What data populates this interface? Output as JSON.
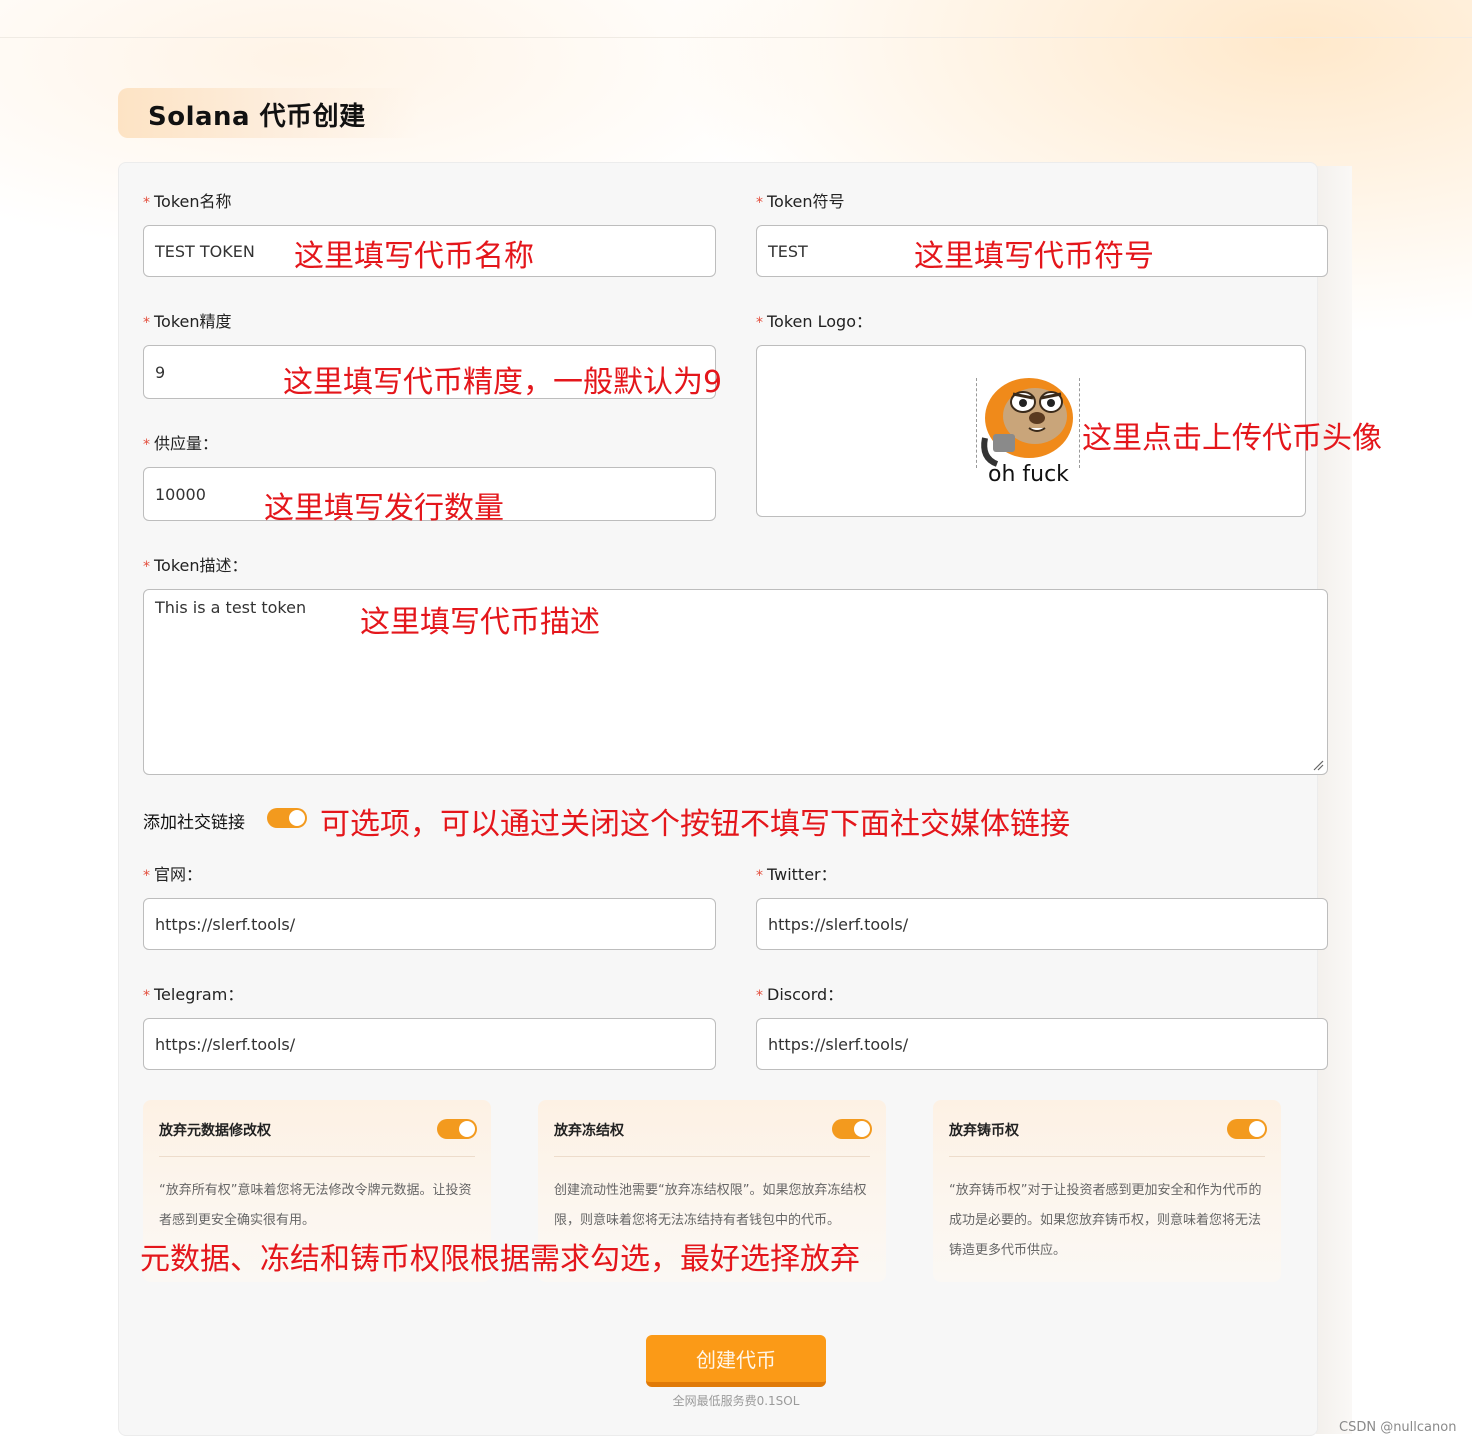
{
  "page": {
    "title": "Solana 代币创建",
    "watermark": "CSDN @nullcanon"
  },
  "colors": {
    "accent": "#f39a1e",
    "required": "#e34d3c",
    "annotation": "#e4161b",
    "button": "#fb9a17"
  },
  "form": {
    "name": {
      "label": "Token名称",
      "value": "TEST TOKEN"
    },
    "symbol": {
      "label": "Token符号",
      "value": "TEST"
    },
    "decimals": {
      "label": "Token精度",
      "value": "9"
    },
    "logo": {
      "label": "Token Logo：",
      "caption": "oh fuck"
    },
    "supply": {
      "label": "供应量：",
      "value": "10000"
    },
    "description": {
      "label": "Token描述：",
      "value": "This is a test token"
    },
    "social_toggle_label": "添加社交链接",
    "website": {
      "label": "官网：",
      "value": "https://slerf.tools/"
    },
    "twitter": {
      "label": "Twitter：",
      "value": "https://slerf.tools/"
    },
    "telegram": {
      "label": "Telegram：",
      "value": "https://slerf.tools/"
    },
    "discord": {
      "label": "Discord：",
      "value": "https://slerf.tools/"
    }
  },
  "cards": [
    {
      "title": "放弃元数据修改权",
      "desc": "“放弃所有权”意味着您将无法修改令牌元数据。让投资者感到更安全确实很有用。"
    },
    {
      "title": "放弃冻结权",
      "desc": "创建流动性池需要“放弃冻结权限”。如果您放弃冻结权限，则意味着您将无法冻结持有者钱包中的代币。"
    },
    {
      "title": "放弃铸币权",
      "desc": "“放弃铸币权”对于让投资者感到更加安全和作为代币的成功是必要的。如果您放弃铸币权，则意味着您将无法铸造更多代币供应。"
    }
  ],
  "submit": {
    "label": "创建代币",
    "fee_note": "全网最低服务费0.1SOL"
  },
  "annotations": {
    "name": "这里填写代币名称",
    "symbol": "这里填写代币符号",
    "decimals": "这里填写代币精度，一般默认为9",
    "logo": "这里点击上传代币头像",
    "supply": "这里填写发行数量",
    "description": "这里填写代币描述",
    "social": "可选项，可以通过关闭这个按钮不填写下面社交媒体链接",
    "permissions": "元数据、冻结和铸币权限根据需求勾选，最好选择放弃"
  }
}
